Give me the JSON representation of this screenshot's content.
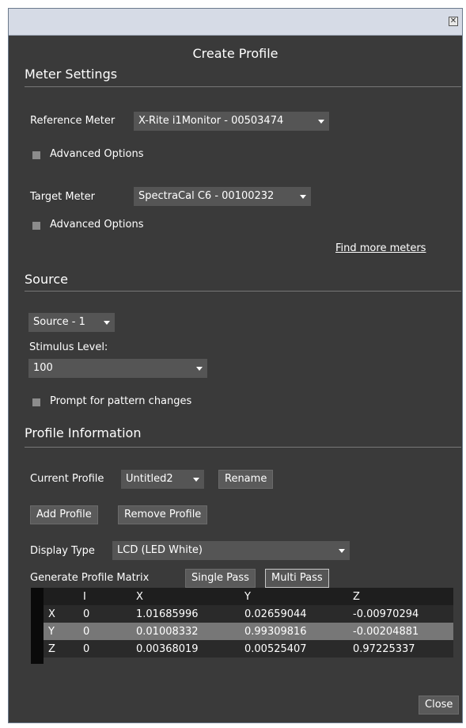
{
  "dialog": {
    "title": "Create Profile",
    "close_label": "Close"
  },
  "meter_settings": {
    "heading": "Meter Settings",
    "reference_label": "Reference Meter",
    "reference_value": "X-Rite i1Monitor - 00503474",
    "reference_advanced": "Advanced Options",
    "target_label": "Target Meter",
    "target_value": "SpectraCal C6 - 00100232",
    "target_advanced": "Advanced Options",
    "find_more": "Find more meters"
  },
  "source": {
    "heading": "Source",
    "source_value": "Source - 1",
    "stimulus_label": "Stimulus Level:",
    "stimulus_value": "100",
    "prompt_label": "Prompt for pattern changes"
  },
  "profile_info": {
    "heading": "Profile Information",
    "current_label": "Current Profile",
    "current_value": "Untitled2",
    "rename": "Rename",
    "add": "Add Profile",
    "remove": "Remove Profile",
    "display_type_label": "Display Type",
    "display_type_value": "LCD (LED White)",
    "generate_label": "Generate Profile Matrix",
    "single_pass": "Single Pass",
    "multi_pass": "Multi Pass"
  },
  "matrix": {
    "headers": [
      "",
      "I",
      "X",
      "Y",
      "Z"
    ],
    "rows": [
      [
        "X",
        "0",
        "1.01685996",
        "0.02659044",
        "-0.00970294"
      ],
      [
        "Y",
        "0",
        "0.01008332",
        "0.99309816",
        "-0.00204881"
      ],
      [
        "Z",
        "0",
        "0.00368019",
        "0.00525407",
        "0.97225337"
      ]
    ]
  }
}
